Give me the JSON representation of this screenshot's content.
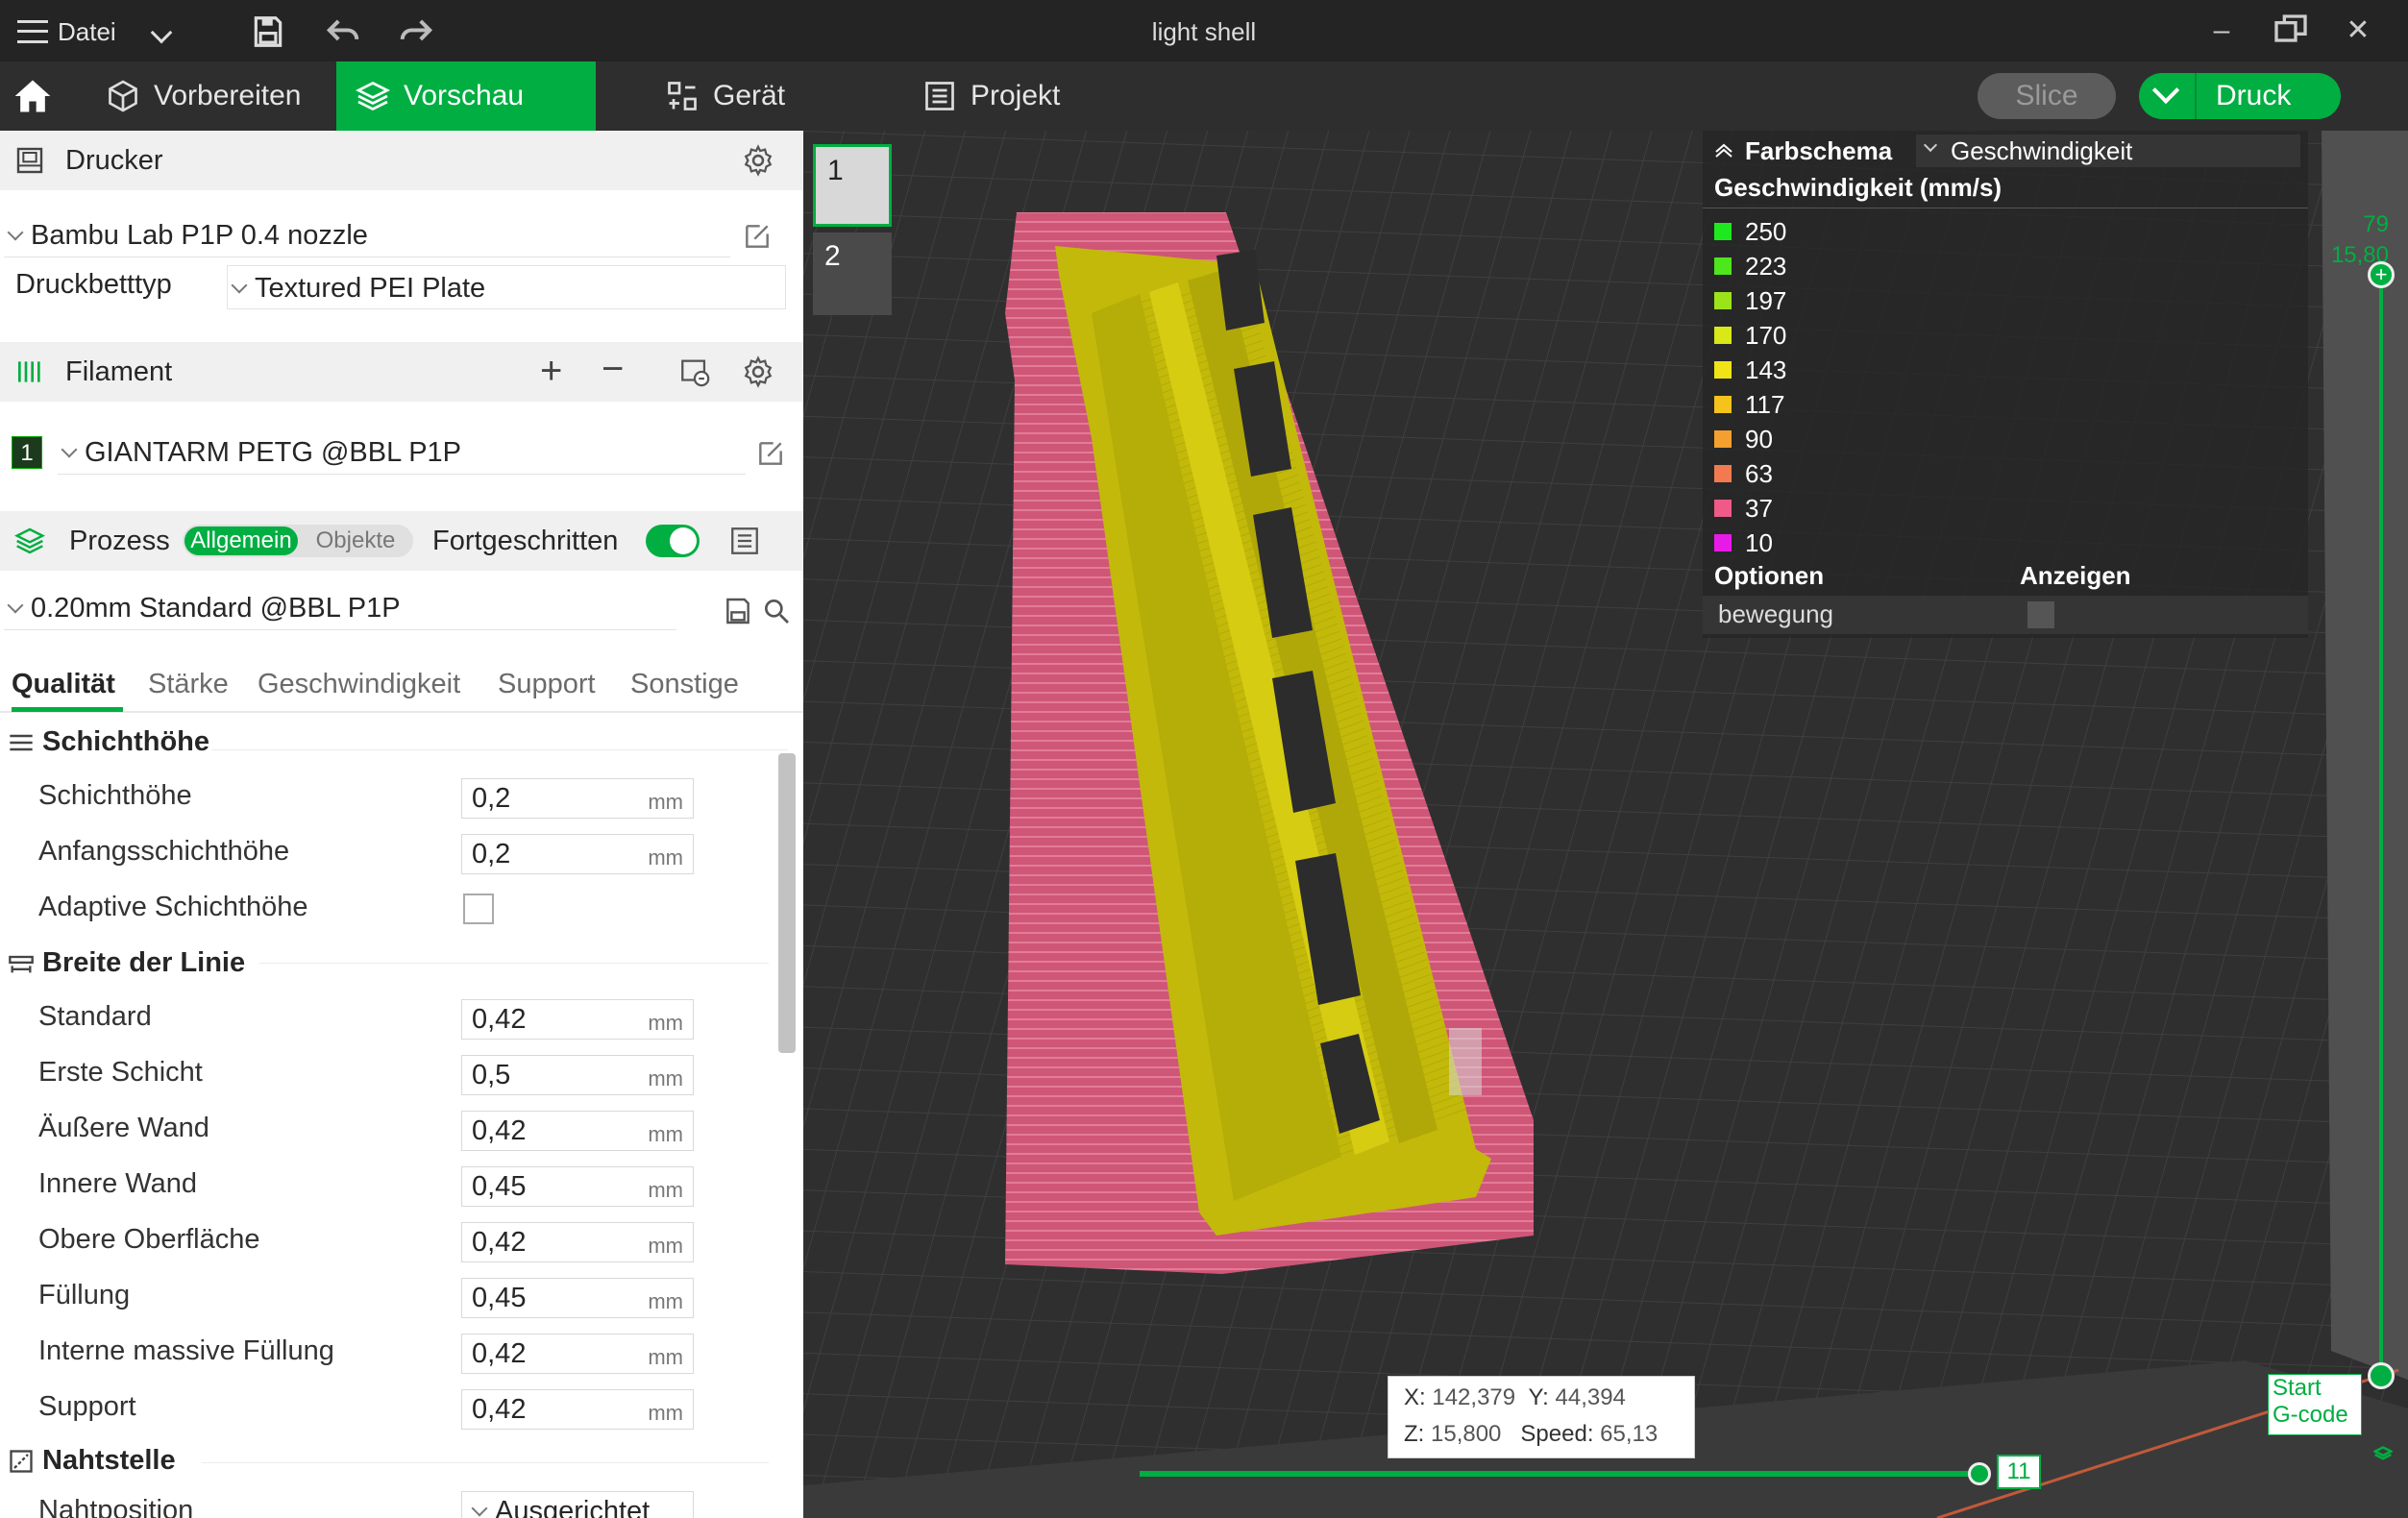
{
  "titlebar": {
    "menu_label": "Datei",
    "window_title": "light shell"
  },
  "nav": {
    "tabs": [
      {
        "label": "Vorbereiten"
      },
      {
        "label": "Vorschau"
      },
      {
        "label": "Gerät"
      },
      {
        "label": "Projekt"
      }
    ],
    "active_tab": "Vorschau",
    "slice_label": "Slice",
    "print_label": "Druck"
  },
  "sidebar": {
    "printer": {
      "header": "Drucker",
      "printer_name": "Bambu Lab P1P 0.4 nozzle",
      "bed_type_label": "Druckbetttyp",
      "bed_type_value": "Textured PEI Plate"
    },
    "filament": {
      "header": "Filament",
      "slot_number": "1",
      "filament_name": "GIANTARM PETG @BBL P1P"
    },
    "process": {
      "header": "Prozess",
      "toggle_global": "Allgemein",
      "toggle_objects": "Objekte",
      "advanced_label": "Fortgeschritten",
      "preset_name": "0.20mm Standard @BBL P1P"
    },
    "tabs": [
      "Qualität",
      "Stärke",
      "Geschwindigkeit",
      "Support",
      "Sonstige"
    ],
    "groups": {
      "layer_height": {
        "title": "Schichthöhe",
        "rows": [
          {
            "label": "Schichthöhe",
            "value": "0,2",
            "unit": "mm"
          },
          {
            "label": "Anfangsschichthöhe",
            "value": "0,2",
            "unit": "mm"
          }
        ],
        "adaptive_label": "Adaptive Schichthöhe"
      },
      "line_width": {
        "title": "Breite der Linie",
        "rows": [
          {
            "label": "Standard",
            "value": "0,42",
            "unit": "mm"
          },
          {
            "label": "Erste Schicht",
            "value": "0,5",
            "unit": "mm"
          },
          {
            "label": "Äußere Wand",
            "value": "0,42",
            "unit": "mm"
          },
          {
            "label": "Innere Wand",
            "value": "0,45",
            "unit": "mm"
          },
          {
            "label": "Obere Oberfläche",
            "value": "0,42",
            "unit": "mm"
          },
          {
            "label": "Füllung",
            "value": "0,45",
            "unit": "mm"
          },
          {
            "label": "Interne massive Füllung",
            "value": "0,42",
            "unit": "mm"
          },
          {
            "label": "Support",
            "value": "0,42",
            "unit": "mm"
          }
        ]
      },
      "seam": {
        "title": "Nahtstelle",
        "row_label": "Nahtposition",
        "row_value": "Ausgerichtet"
      }
    }
  },
  "viewport": {
    "plates": [
      "1",
      "2"
    ],
    "legend": {
      "color_scheme_label": "Farbschema",
      "color_scheme_value": "Geschwindigkeit",
      "speed_title": "Geschwindigkeit (mm/s)",
      "entries": [
        {
          "value": "250",
          "color": "#1ee81e"
        },
        {
          "value": "223",
          "color": "#4ee61c"
        },
        {
          "value": "197",
          "color": "#9ce41a"
        },
        {
          "value": "170",
          "color": "#d8e818"
        },
        {
          "value": "143",
          "color": "#f0e418"
        },
        {
          "value": "117",
          "color": "#f6c21c"
        },
        {
          "value": "90",
          "color": "#f4a030"
        },
        {
          "value": "63",
          "color": "#f27a50"
        },
        {
          "value": "37",
          "color": "#f05a88"
        },
        {
          "value": "10",
          "color": "#e81ae8"
        }
      ],
      "options_label": "Optionen",
      "show_label": "Anzeigen",
      "option_row": "bewegung"
    },
    "vertical_slider": {
      "top_layer": "79",
      "top_height": "15,80"
    },
    "coords": {
      "x": "142,379",
      "y": "44,394",
      "z": "15,800",
      "speed": "65,13"
    },
    "horizontal_slider": {
      "value": "11"
    },
    "gcode_label_1": "Start",
    "gcode_label_2": "G-code",
    "colors": {
      "accent": "#00ae42",
      "model": "#c8c00a",
      "brim": "#d85a7c"
    }
  }
}
